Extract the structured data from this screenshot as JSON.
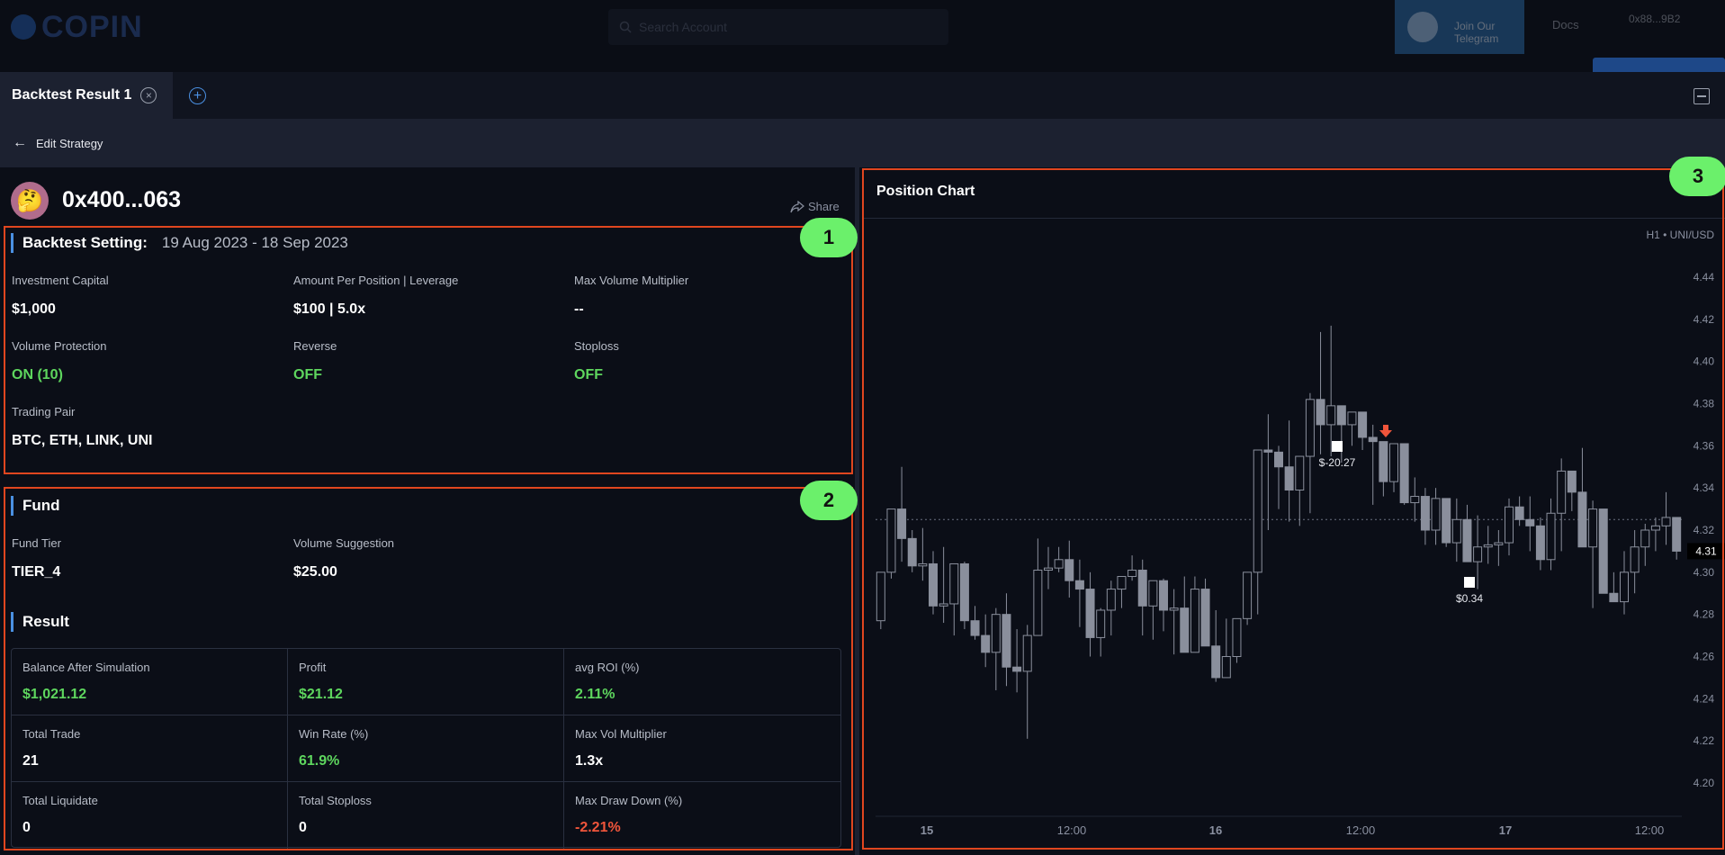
{
  "background_header": {
    "logo_text": "COPIN",
    "search_placeholder": "Search Account",
    "telegram_label": "Join Our Telegram",
    "nav_item": "Docs",
    "account_label": "0x88...9B2"
  },
  "tabs": [
    {
      "label": "Backtest Result 1"
    }
  ],
  "toolbar": {
    "edit_label": "Edit Strategy"
  },
  "account": {
    "avatar_emoji": "🤔",
    "address": "0x400...063",
    "share_label": "Share"
  },
  "badges": [
    "1",
    "2",
    "3"
  ],
  "backtest": {
    "title": "Backtest Setting:",
    "date_range": "19 Aug 2023 - 18 Sep 2023",
    "fields": [
      {
        "label": "Investment Capital",
        "value": "$1,000",
        "color": "white"
      },
      {
        "label": "Amount Per Position | Leverage",
        "value": "$100 | 5.0x",
        "color": "white"
      },
      {
        "label": "Max Volume Multiplier",
        "value": "--",
        "color": "white"
      },
      {
        "label": "Volume Protection",
        "value": "ON (10)",
        "color": "green"
      },
      {
        "label": "Reverse",
        "value": "OFF",
        "color": "green"
      },
      {
        "label": "Stoploss",
        "value": "OFF",
        "color": "green"
      },
      {
        "label": "Trading Pair",
        "value": "BTC, ETH, LINK, UNI",
        "color": "white"
      }
    ]
  },
  "fund": {
    "title": "Fund",
    "fields": [
      {
        "label": "Fund Tier",
        "value": "TIER_4"
      },
      {
        "label": "Volume Suggestion",
        "value": "$25.00"
      }
    ]
  },
  "result": {
    "title": "Result",
    "cells": [
      {
        "label": "Balance After Simulation",
        "value": "$1,021.12",
        "color": "green"
      },
      {
        "label": "Profit",
        "value": "$21.12",
        "color": "green"
      },
      {
        "label": "avg ROI (%)",
        "value": "2.11%",
        "color": "green"
      },
      {
        "label": "Total Trade",
        "value": "21",
        "color": "white"
      },
      {
        "label": "Win Rate (%)",
        "value": "61.9%",
        "color": "green"
      },
      {
        "label": "Max Vol Multiplier",
        "value": "1.3x",
        "color": "white"
      },
      {
        "label": "Total Liquidate",
        "value": "0",
        "color": "white"
      },
      {
        "label": "Total Stoploss",
        "value": "0",
        "color": "white"
      },
      {
        "label": "Max Draw Down (%)",
        "value": "-2.21%",
        "color": "red"
      }
    ]
  },
  "colors": {
    "accent": "#4a90e2",
    "positive": "#5ed65e",
    "negative": "#f0553b",
    "highlight_border": "#e0461f",
    "badge": "#6bf06b"
  },
  "chart": {
    "title": "Position Chart",
    "symbol_label": "H1 • UNI/USD",
    "current_price": "4.31",
    "markers": [
      {
        "label": "$-20.27"
      },
      {
        "label": "$0.34"
      }
    ]
  },
  "chart_data": {
    "type": "candlestick",
    "title": "Position Chart",
    "ylim": [
      4.19,
      4.45
    ],
    "yticks": [
      "4.20",
      "4.22",
      "4.24",
      "4.26",
      "4.28",
      "4.30",
      "4.32",
      "4.34",
      "4.36",
      "4.38",
      "4.40",
      "4.42",
      "4.44"
    ],
    "xticks": [
      "15",
      "12:00",
      "16",
      "12:00",
      "17",
      "12:00"
    ],
    "current_price": 4.31,
    "series": [
      {
        "name": "UNI/USD",
        "ohlc": [
          [
            4.277,
            4.3,
            4.273,
            4.3
          ],
          [
            4.3,
            4.33,
            4.297,
            4.33
          ],
          [
            4.33,
            4.35,
            4.305,
            4.316
          ],
          [
            4.316,
            4.32,
            4.3,
            4.303
          ],
          [
            4.303,
            4.321,
            4.296,
            4.304
          ],
          [
            4.304,
            4.31,
            4.28,
            4.284
          ],
          [
            4.284,
            4.312,
            4.276,
            4.285
          ],
          [
            4.285,
            4.302,
            4.27,
            4.304
          ],
          [
            4.304,
            4.305,
            4.273,
            4.277
          ],
          [
            4.277,
            4.284,
            4.268,
            4.27
          ],
          [
            4.27,
            4.28,
            4.255,
            4.262
          ],
          [
            4.262,
            4.283,
            4.244,
            4.28
          ],
          [
            4.28,
            4.29,
            4.246,
            4.255
          ],
          [
            4.255,
            4.273,
            4.243,
            4.253
          ],
          [
            4.253,
            4.275,
            4.221,
            4.27
          ],
          [
            4.27,
            4.316,
            4.27,
            4.301
          ],
          [
            4.301,
            4.312,
            4.292,
            4.302
          ],
          [
            4.302,
            4.312,
            4.3,
            4.306
          ],
          [
            4.306,
            4.315,
            4.288,
            4.296
          ],
          [
            4.296,
            4.306,
            4.274,
            4.292
          ],
          [
            4.292,
            4.3,
            4.26,
            4.269
          ],
          [
            4.269,
            4.283,
            4.26,
            4.282
          ],
          [
            4.282,
            4.296,
            4.27,
            4.292
          ],
          [
            4.292,
            4.298,
            4.283,
            4.298
          ],
          [
            4.298,
            4.308,
            4.296,
            4.301
          ],
          [
            4.301,
            4.306,
            4.27,
            4.284
          ],
          [
            4.284,
            4.296,
            4.268,
            4.296
          ],
          [
            4.296,
            4.297,
            4.272,
            4.282
          ],
          [
            4.282,
            4.292,
            4.261,
            4.283
          ],
          [
            4.283,
            4.298,
            4.265,
            4.262
          ],
          [
            4.262,
            4.298,
            4.262,
            4.292
          ],
          [
            4.292,
            4.297,
            4.268,
            4.265
          ],
          [
            4.265,
            4.282,
            4.248,
            4.25
          ],
          [
            4.25,
            4.278,
            4.25,
            4.26
          ],
          [
            4.26,
            4.272,
            4.257,
            4.278
          ],
          [
            4.278,
            4.3,
            4.275,
            4.3
          ],
          [
            4.3,
            4.34,
            4.28,
            4.358
          ],
          [
            4.358,
            4.375,
            4.32,
            4.357
          ],
          [
            4.357,
            4.36,
            4.33,
            4.35
          ],
          [
            4.35,
            4.372,
            4.324,
            4.339
          ],
          [
            4.339,
            4.34,
            4.322,
            4.355
          ],
          [
            4.355,
            4.385,
            4.328,
            4.382
          ],
          [
            4.382,
            4.414,
            4.356,
            4.37
          ],
          [
            4.37,
            4.417,
            4.355,
            4.379
          ],
          [
            4.379,
            4.375,
            4.352,
            4.37
          ],
          [
            4.37,
            4.376,
            4.36,
            4.376
          ],
          [
            4.376,
            4.375,
            4.358,
            4.364
          ],
          [
            4.364,
            4.37,
            4.332,
            4.362
          ],
          [
            4.362,
            4.362,
            4.336,
            4.343
          ],
          [
            4.343,
            4.361,
            4.338,
            4.361
          ],
          [
            4.361,
            4.35,
            4.332,
            4.333
          ],
          [
            4.333,
            4.345,
            4.324,
            4.336
          ],
          [
            4.336,
            4.34,
            4.313,
            4.32
          ],
          [
            4.32,
            4.34,
            4.313,
            4.335
          ],
          [
            4.335,
            4.328,
            4.312,
            4.314
          ],
          [
            4.314,
            4.335,
            4.305,
            4.325
          ],
          [
            4.325,
            4.332,
            4.308,
            4.305
          ],
          [
            4.305,
            4.327,
            4.292,
            4.312
          ],
          [
            4.312,
            4.322,
            4.304,
            4.313
          ],
          [
            4.313,
            4.32,
            4.303,
            4.314
          ],
          [
            4.314,
            4.335,
            4.308,
            4.331
          ],
          [
            4.331,
            4.336,
            4.322,
            4.325
          ],
          [
            4.325,
            4.336,
            4.31,
            4.322
          ],
          [
            4.322,
            4.326,
            4.301,
            4.306
          ],
          [
            4.306,
            4.335,
            4.301,
            4.328
          ],
          [
            4.328,
            4.354,
            4.31,
            4.348
          ],
          [
            4.348,
            4.342,
            4.329,
            4.338
          ],
          [
            4.338,
            4.359,
            4.322,
            4.312
          ],
          [
            4.312,
            4.334,
            4.283,
            4.33
          ],
          [
            4.33,
            4.312,
            4.291,
            4.29
          ],
          [
            4.29,
            4.3,
            4.288,
            4.286
          ],
          [
            4.286,
            4.31,
            4.28,
            4.3
          ],
          [
            4.3,
            4.32,
            4.29,
            4.312
          ],
          [
            4.312,
            4.323,
            4.303,
            4.32
          ],
          [
            4.32,
            4.326,
            4.31,
            4.322
          ],
          [
            4.322,
            4.338,
            4.313,
            4.326
          ],
          [
            4.326,
            4.323,
            4.306,
            4.31
          ]
        ]
      }
    ],
    "annotations": [
      {
        "type": "entry",
        "label": "$-20.27",
        "y": 4.356
      },
      {
        "type": "short-arrow",
        "y": 4.365
      },
      {
        "type": "entry",
        "label": "$0.34",
        "y": 4.294
      }
    ]
  }
}
